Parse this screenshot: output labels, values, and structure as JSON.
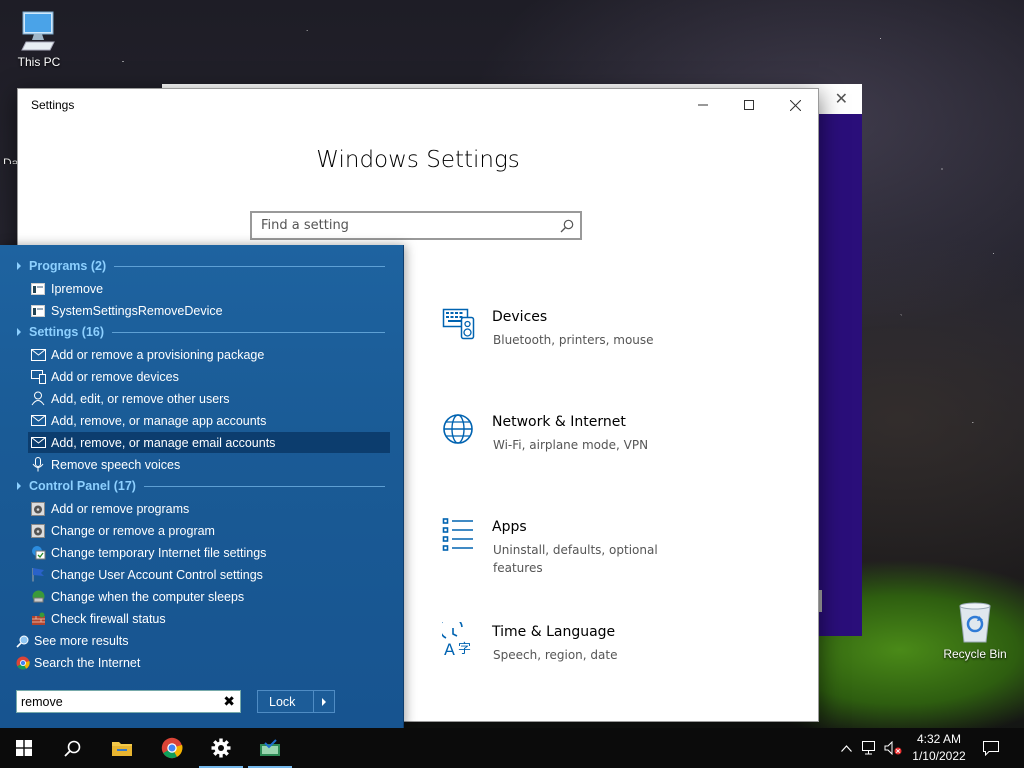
{
  "desktop": {
    "this_pc_label": "This PC",
    "partial_label": "Da",
    "recycle_bin_label": "Recycle Bin"
  },
  "settings_window": {
    "title": "Windows Settings",
    "window_title": "Settings",
    "search_placeholder": "Find a setting",
    "tiles": [
      {
        "name": "Devices",
        "desc": "Bluetooth, printers, mouse",
        "icon": "devices-icon"
      },
      {
        "name": "Network & Internet",
        "desc": "Wi-Fi, airplane mode, VPN",
        "icon": "globe-icon"
      },
      {
        "name": "Apps",
        "desc": "Uninstall, defaults, optional features",
        "icon": "apps-list-icon"
      },
      {
        "name": "Time & Language",
        "desc": "Speech, region, date",
        "icon": "time-language-icon"
      }
    ]
  },
  "start_menu": {
    "groups": {
      "programs": "Programs (2)",
      "settings": "Settings (16)",
      "control_panel": "Control Panel (17)"
    },
    "programs": [
      "Ipremove",
      "SystemSettingsRemoveDevice"
    ],
    "settings_items": [
      "Add or remove a provisioning package",
      "Add or remove devices",
      "Add, edit, or remove other users",
      "Add, remove, or manage app accounts",
      "Add, remove, or manage email accounts",
      "Remove speech voices"
    ],
    "control_panel_items": [
      "Add or remove programs",
      "Change or remove a program",
      "Change temporary Internet file settings",
      "Change User Account Control settings",
      "Change when the computer sleeps",
      "Check firewall status"
    ],
    "see_more": "See more results",
    "search_internet": "Search the Internet",
    "search_value": "remove",
    "lock_label": "Lock",
    "selected_item": "Add, remove, or manage email accounts"
  },
  "taskbar": {
    "time": "4:32 AM",
    "date": "1/10/2022"
  },
  "colors": {
    "start_menu_bg": "#1a5b96",
    "selected_row": "#0c3d6e",
    "group_header": "#8dd0ff",
    "icon_blue": "#0063b1",
    "back_window": "#2a0e7a",
    "taskbar": "#0b0b0b"
  }
}
